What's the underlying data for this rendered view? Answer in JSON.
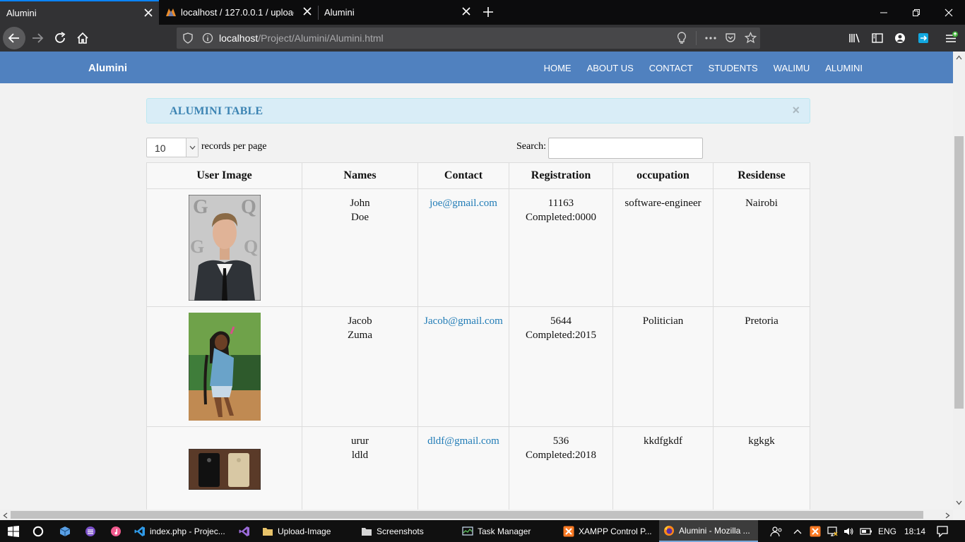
{
  "browser": {
    "tabs": [
      {
        "title": "Alumini",
        "active": true
      },
      {
        "title": "localhost / 127.0.0.1 / upload_i",
        "active": false
      },
      {
        "title": "Alumini",
        "active": false
      }
    ],
    "url_host": "localhost",
    "url_path": "/Project/Alumini/Alumini.html"
  },
  "site": {
    "brand": "Alumini",
    "nav": [
      "HOME",
      "ABOUT US",
      "CONTACT",
      "STUDENTS",
      "WALIMU",
      "ALUMINI"
    ]
  },
  "alert": {
    "title": "ALUMINI TABLE",
    "close": "×"
  },
  "table_controls": {
    "length_value": "10",
    "length_label": "records per page",
    "search_label": "Search:",
    "search_value": ""
  },
  "table": {
    "headers": [
      "User Image",
      "Names",
      "Contact",
      "Registration",
      "occupation",
      "Residense"
    ],
    "rows": [
      {
        "first": "John",
        "last": "Doe",
        "email": "joe@gmail.com",
        "reg": "11163",
        "completed": "Completed:0000",
        "occupation": "software-engineer",
        "residence": "Nairobi"
      },
      {
        "first": "Jacob",
        "last": "Zuma",
        "email": "Jacob@gmail.com",
        "reg": "5644",
        "completed": "Completed:2015",
        "occupation": "Politician",
        "residence": "Pretoria"
      },
      {
        "first": "urur",
        "last": "ldld",
        "email": "dldf@gmail.com",
        "reg": "536",
        "completed": "Completed:2018",
        "occupation": "kkdfgkdf",
        "residence": "kgkgk"
      }
    ]
  },
  "taskbar": {
    "items": [
      "index.php - Projec...",
      "Upload-Image",
      "Screenshots",
      "Task Manager",
      "XAMPP Control P...",
      "Alumini - Mozilla ..."
    ],
    "lang": "ENG",
    "time": "18:14"
  },
  "colors": {
    "navbar": "#5081bf",
    "alert_bg": "#d9edf7",
    "link": "#1f7bb6",
    "taskbar": "#101010"
  }
}
